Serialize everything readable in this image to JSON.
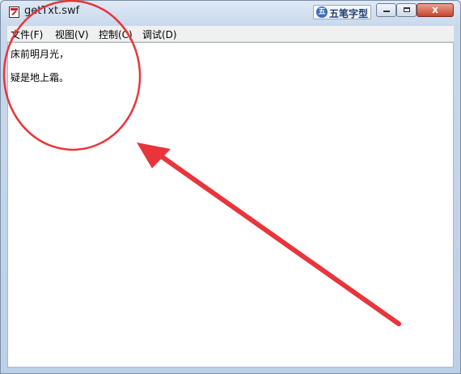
{
  "window": {
    "title": "getTxt.swf"
  },
  "ime": {
    "label": "五笔字型",
    "logo": "五"
  },
  "caption_buttons": {
    "close_glyph": "x"
  },
  "menu": [
    {
      "label": "文件(F)"
    },
    {
      "label": "视图(V)"
    },
    {
      "label": "控制(C)"
    },
    {
      "label": "调试(D)"
    }
  ],
  "content": {
    "lines": [
      "床前明月光，",
      "疑是地上霜。"
    ]
  },
  "colors": {
    "annotation": "#e8353c",
    "close_button": "#c7432d"
  }
}
